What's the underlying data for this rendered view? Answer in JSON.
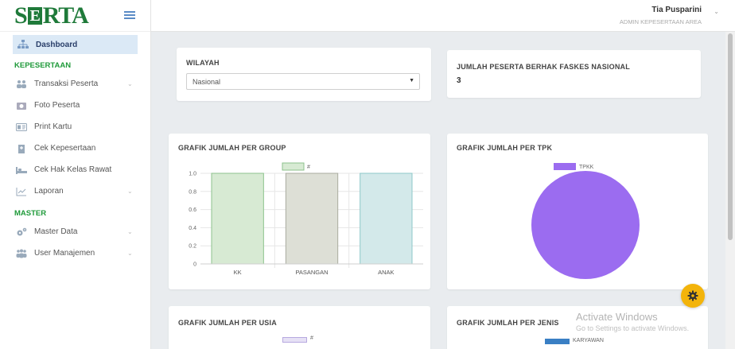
{
  "logo": {
    "text_left": "S",
    "text_box": "E",
    "text_right": "RTA"
  },
  "header": {
    "user_name": "Tia Pusparini",
    "user_role": "ADMIN KEPESERTAAN AREA"
  },
  "sidebar": {
    "dashboard": "Dashboard",
    "section_kepesertaan": "KEPESERTAAN",
    "items_kepesertaan": [
      {
        "label": "Transaksi Peserta"
      },
      {
        "label": "Foto Peserta"
      },
      {
        "label": "Print Kartu"
      },
      {
        "label": "Cek Kepesertaan"
      },
      {
        "label": "Cek Hak Kelas Rawat"
      },
      {
        "label": "Laporan"
      }
    ],
    "section_master": "MASTER",
    "items_master": [
      {
        "label": "Master Data"
      },
      {
        "label": "User Manajemen"
      }
    ]
  },
  "wilayah": {
    "title": "WILAYAH",
    "selected": "Nasional"
  },
  "jumlah_peserta": {
    "title": "JUMLAH PESERTA BERHAK FASKES NASIONAL",
    "value": "3"
  },
  "chart_data": [
    {
      "type": "bar",
      "title": "GRAFIK JUMLAH PER GROUP",
      "categories": [
        "KK",
        "PASANGAN",
        "ANAK"
      ],
      "series": [
        {
          "name": "#",
          "values": [
            1,
            1,
            1
          ]
        }
      ],
      "colors": [
        "#d7ead3",
        "#dddfd6",
        "#d3e9ea"
      ],
      "border_colors": [
        "#8cc28c",
        "#a9ab9f",
        "#8ec8c9"
      ],
      "yticks": [
        "0",
        "0.2",
        "0.4",
        "0.6",
        "0.8",
        "1.0"
      ],
      "ylim": [
        0,
        1.0
      ],
      "legend": "top"
    },
    {
      "type": "pie",
      "title": "GRAFIK JUMLAH PER TPK",
      "labels": [
        "TPKK"
      ],
      "values": [
        1
      ],
      "colors": [
        "#9b6cf0"
      ],
      "legend": "top"
    },
    {
      "type": "bar",
      "title": "GRAFIK JUMLAH PER USIA",
      "series": [
        {
          "name": "#"
        }
      ],
      "legend": "top"
    },
    {
      "type": "bar",
      "title": "GRAFIK JUMLAH PER JENIS",
      "series": [
        {
          "name": "KARYAWAN"
        }
      ],
      "legend": "top"
    }
  ],
  "watermark": {
    "line1": "Activate Windows",
    "line2": "Go to Settings to activate Windows."
  }
}
